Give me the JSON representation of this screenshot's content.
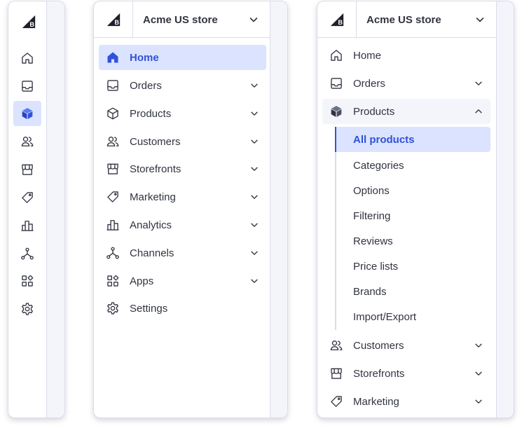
{
  "store": {
    "name": "Acme US store"
  },
  "nav": {
    "home": "Home",
    "orders": "Orders",
    "products": "Products",
    "customers": "Customers",
    "storefronts": "Storefronts",
    "marketing": "Marketing",
    "analytics": "Analytics",
    "channels": "Channels",
    "apps": "Apps",
    "settings": "Settings"
  },
  "products_sub": {
    "all": "All products",
    "categories": "Categories",
    "options": "Options",
    "filtering": "Filtering",
    "reviews": "Reviews",
    "price_lists": "Price lists",
    "brands": "Brands",
    "import_export": "Import/Export"
  },
  "icons": [
    "bigcommerce-logo-icon",
    "home-icon",
    "orders-icon",
    "products-icon",
    "customers-icon",
    "storefronts-icon",
    "marketing-icon",
    "analytics-icon",
    "channels-icon",
    "apps-icon",
    "settings-icon",
    "chevron-down-icon",
    "chevron-up-icon"
  ],
  "colors": {
    "accent": "#3052da",
    "active_bg": "#dbe3fe",
    "text": "#313440",
    "border": "#d9dce9",
    "strip": "#f4f5fb"
  }
}
